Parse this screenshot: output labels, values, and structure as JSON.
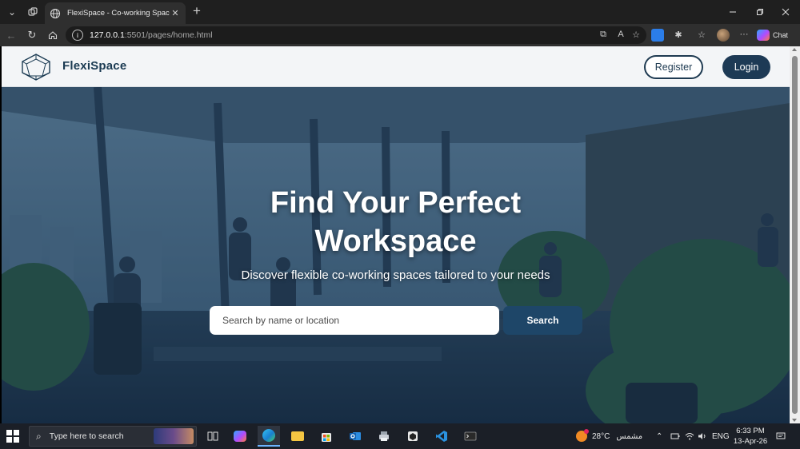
{
  "browser": {
    "tab_title": "FlexiSpace - Co-working Spaces",
    "tab_close": "✕",
    "new_tab": "+",
    "url_host": "127.0.0.1",
    "url_path": ":5501/pages/home.html",
    "copilot_label": "Chat"
  },
  "header": {
    "brand": "FlexiSpace",
    "register_label": "Register",
    "login_label": "Login"
  },
  "hero": {
    "title_line1": "Find Your Perfect",
    "title_line2": "Workspace",
    "subtitle": "Discover flexible co-working spaces tailored to your needs",
    "search_placeholder": "Search by name or location",
    "search_button": "Search"
  },
  "taskbar": {
    "search_placeholder": "Type here to search",
    "weather_temp": "28°C",
    "weather_desc": "مشمس",
    "language": "ENG",
    "time": "6:33 PM",
    "date": "13-Apr-26"
  },
  "colors": {
    "brand_dark": "#1d3a55",
    "search_button": "#1e4668",
    "header_bg": "#f3f5f7"
  }
}
